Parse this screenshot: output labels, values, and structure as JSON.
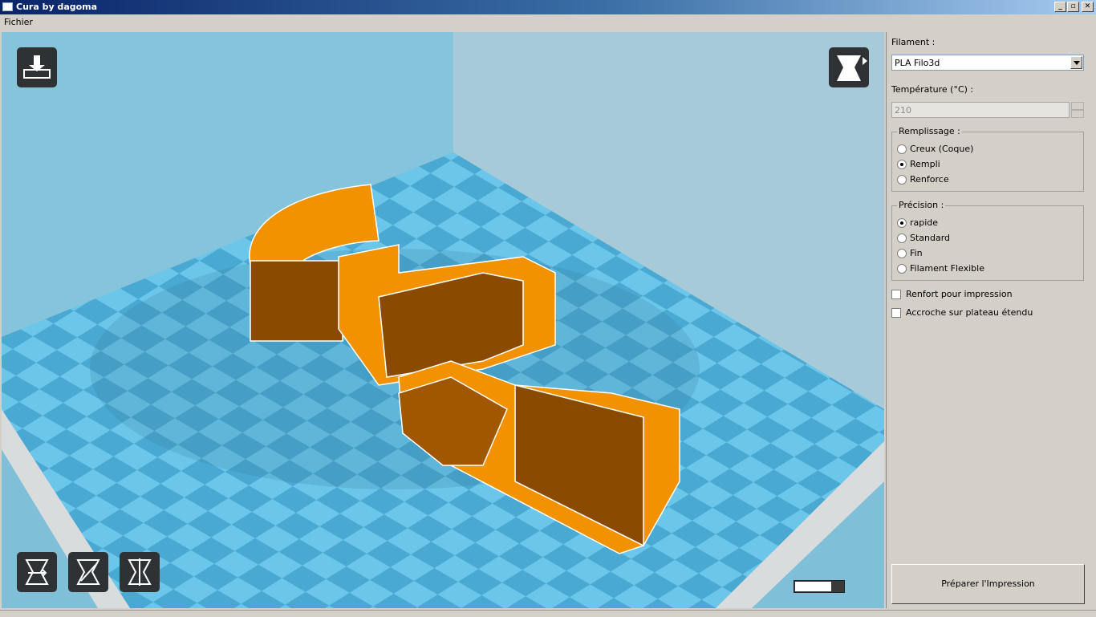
{
  "window": {
    "title": "Cura by dagoma"
  },
  "menu": {
    "items": [
      "Fichier"
    ]
  },
  "viewport": {
    "model_color": "#f39200",
    "bed_color": "#56b4d8",
    "layer_slider_value": 0.75
  },
  "panel": {
    "filament_label": "Filament :",
    "filament_value": "PLA Filo3d",
    "temperature_label": "Température (°C) :",
    "temperature_value": "210",
    "infill": {
      "title": "Remplissage :",
      "options": [
        {
          "label": "Creux (Coque)",
          "selected": false
        },
        {
          "label": "Rempli",
          "selected": true
        },
        {
          "label": "Renforce",
          "selected": false
        }
      ]
    },
    "precision": {
      "title": "Précision :",
      "options": [
        {
          "label": "rapide",
          "selected": true
        },
        {
          "label": "Standard",
          "selected": false
        },
        {
          "label": "Fin",
          "selected": false
        },
        {
          "label": "Filament Flexible",
          "selected": false
        }
      ]
    },
    "checkboxes": [
      {
        "label": "Renfort pour impression",
        "checked": false
      },
      {
        "label": "Accroche sur plateau étendu",
        "checked": false
      }
    ],
    "prepare_button": "Préparer l'Impression"
  },
  "icons": {
    "load": "load-model-icon",
    "view_mode": "view-mode-icon",
    "rotate": "rotate-icon",
    "scale": "scale-icon",
    "mirror": "mirror-icon"
  }
}
